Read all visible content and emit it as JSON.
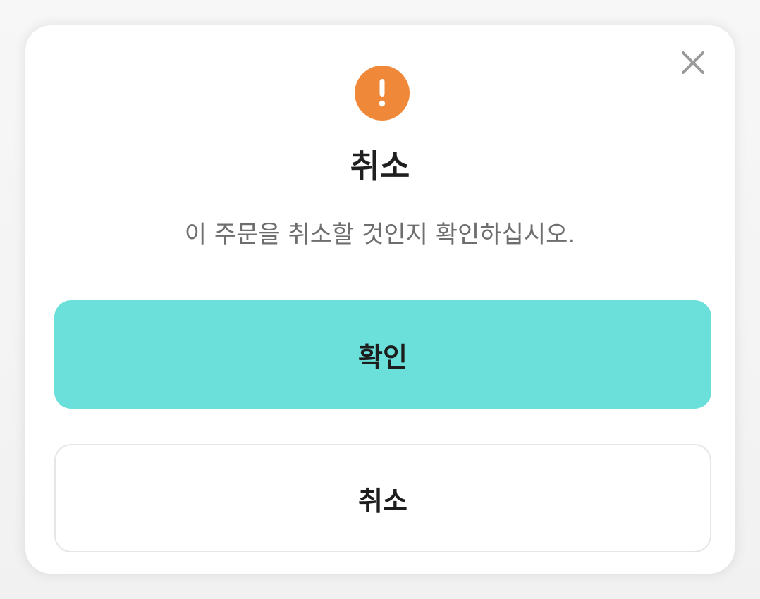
{
  "dialog": {
    "title": "취소",
    "message": "이 주문을 취소할 것인지 확인하십시오.",
    "confirm_label": "확인",
    "cancel_label": "취소",
    "icons": {
      "status": "warning-exclamation-icon",
      "close": "close-x-icon"
    },
    "colors": {
      "warning": "#f0883a",
      "confirm_button": "#6be0da",
      "cancel_border": "#e6e6e6",
      "message_text": "#6e6e6e"
    }
  }
}
